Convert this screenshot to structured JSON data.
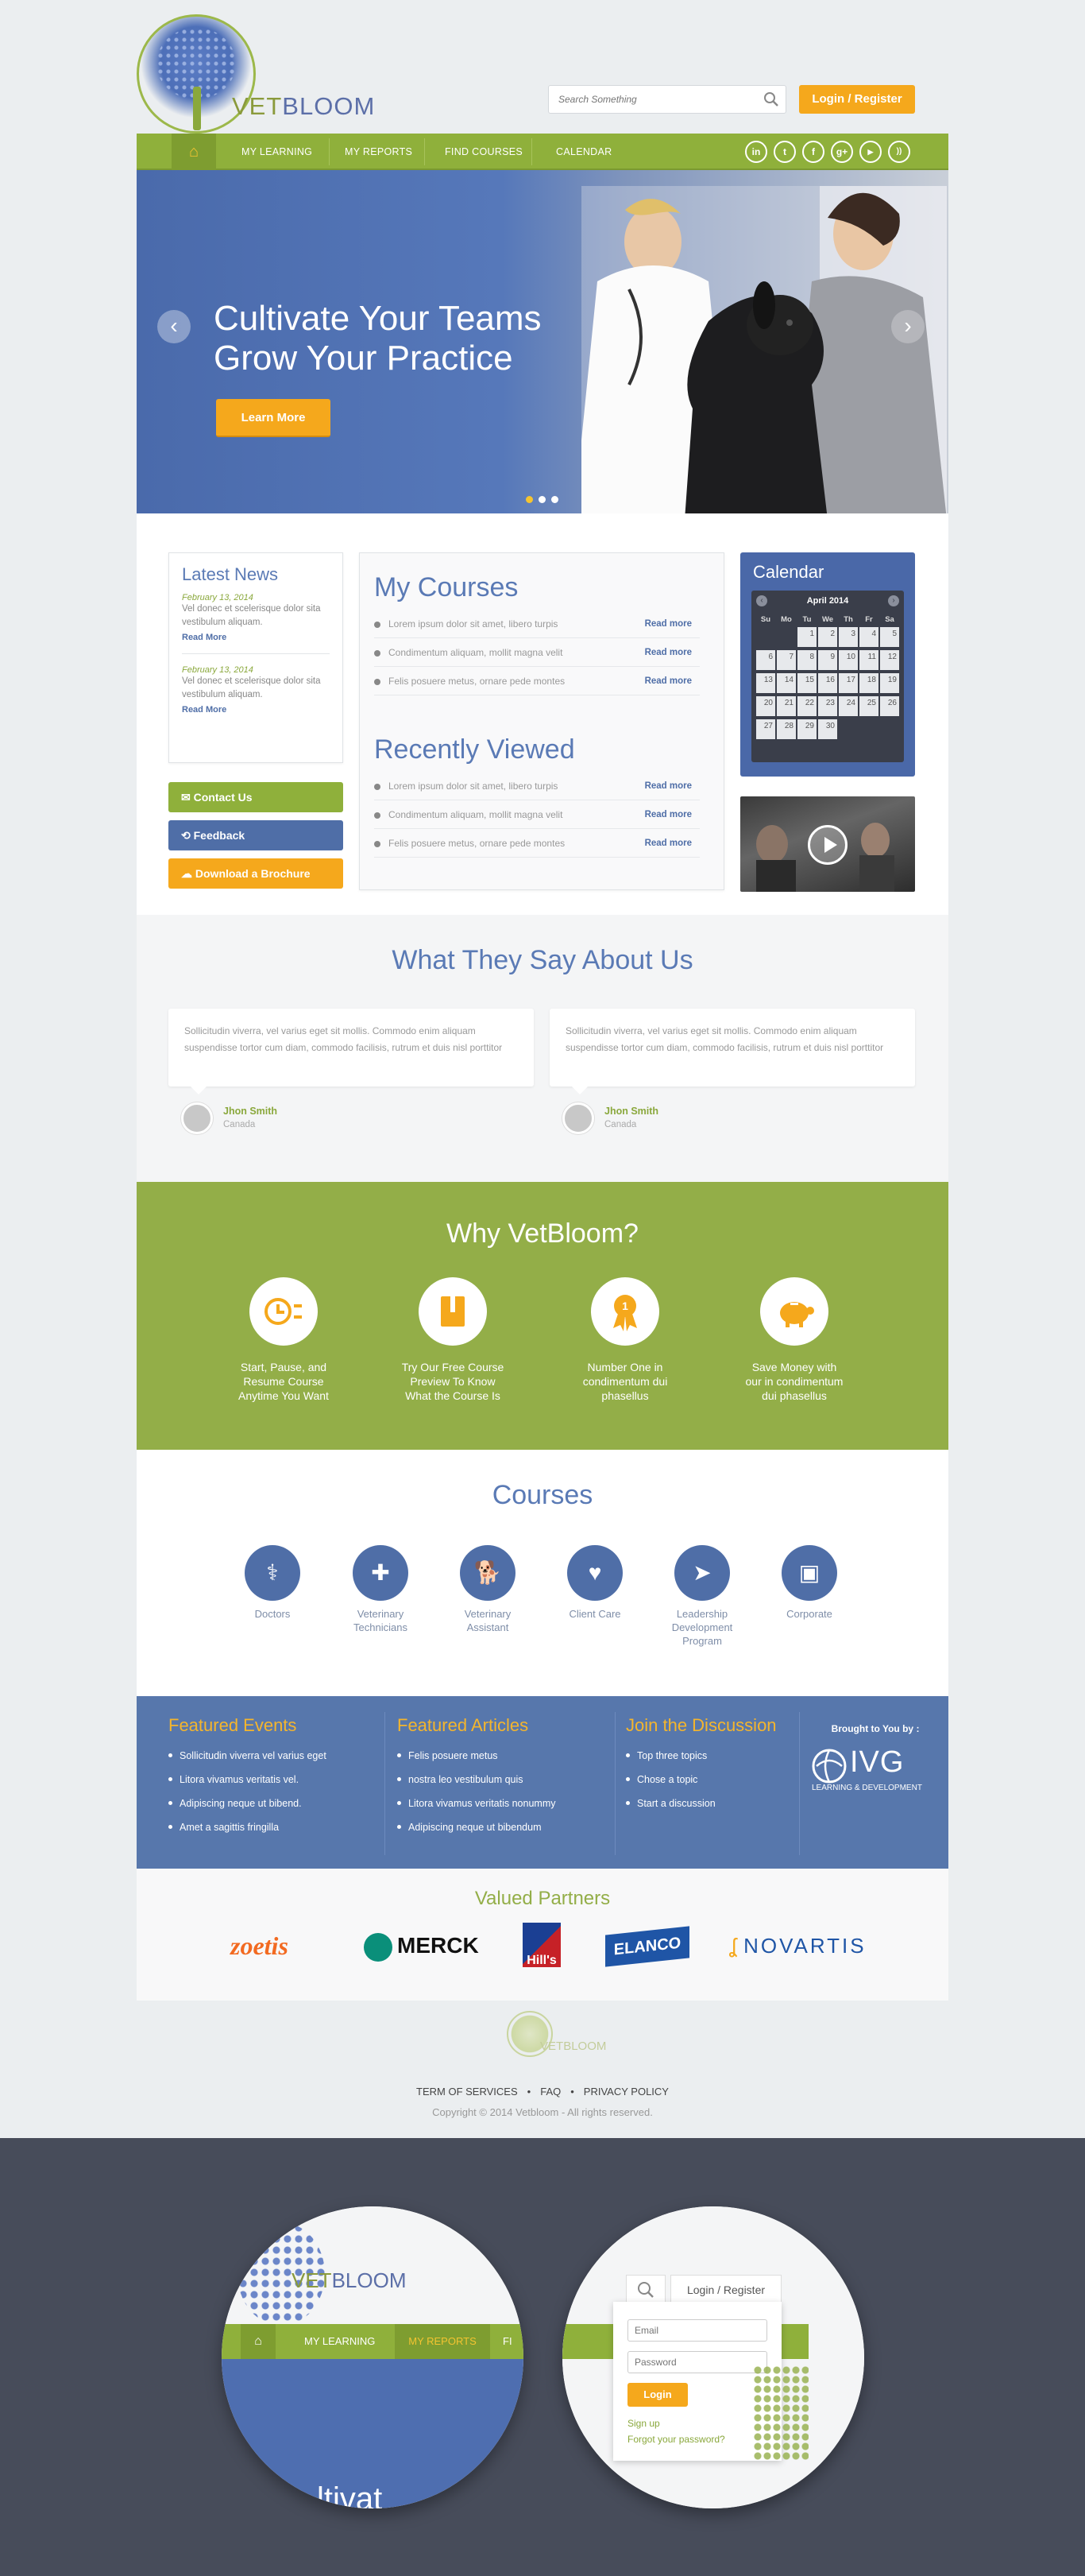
{
  "brand": {
    "name_part1": "VET",
    "name_part2": "BLOOM"
  },
  "search": {
    "placeholder": "Search Something"
  },
  "header": {
    "login_label": "Login / Register"
  },
  "nav": {
    "items": [
      {
        "label": "MY LEARNING"
      },
      {
        "label": "MY REPORTS"
      },
      {
        "label": "FIND COURSES"
      },
      {
        "label": "CALENDAR"
      }
    ],
    "social": [
      {
        "icon": "linkedin-icon",
        "glyph": "in"
      },
      {
        "icon": "twitter-icon",
        "glyph": "t"
      },
      {
        "icon": "facebook-icon",
        "glyph": "f"
      },
      {
        "icon": "googleplus-icon",
        "glyph": "g+"
      },
      {
        "icon": "youtube-icon",
        "glyph": "▶"
      },
      {
        "icon": "rss-icon",
        "glyph": "))"
      }
    ]
  },
  "hero": {
    "title_line1": "Cultivate Your Teams",
    "title_line2": "Grow Your Practice",
    "button": "Learn More"
  },
  "latest_news": {
    "heading": "Latest News",
    "items": [
      {
        "date": "February 13, 2014",
        "text": "Vel donec et scelerisque dolor sita vestibulum aliquam.",
        "link": "Read More"
      },
      {
        "date": "February 13, 2014",
        "text": "Vel donec et scelerisque dolor sita vestibulum aliquam.",
        "link": "Read More"
      }
    ]
  },
  "side_buttons": {
    "contact": "Contact Us",
    "feedback": "Feedback",
    "download": "Download a Brochure"
  },
  "my_courses": {
    "heading": "My Courses",
    "items": [
      {
        "text": "Lorem ipsum dolor sit amet, libero turpis",
        "link": "Read more"
      },
      {
        "text": "Condimentum aliquam, mollit magna velit",
        "link": "Read more"
      },
      {
        "text": "Felis posuere metus, ornare pede montes",
        "link": "Read more"
      }
    ]
  },
  "recently_viewed": {
    "heading": "Recently Viewed",
    "items": [
      {
        "text": "Lorem ipsum dolor sit amet, libero turpis",
        "link": "Read more"
      },
      {
        "text": "Condimentum aliquam, mollit magna velit",
        "link": "Read more"
      },
      {
        "text": "Felis posuere metus, ornare pede montes",
        "link": "Read more"
      }
    ]
  },
  "calendar": {
    "heading": "Calendar",
    "month": "April 2014",
    "weekdays": [
      "Su",
      "Mo",
      "Tu",
      "We",
      "Th",
      "Fr",
      "Sa"
    ],
    "days": [
      "",
      "",
      "1",
      "2",
      "3",
      "4",
      "5",
      "6",
      "7",
      "8",
      "9",
      "10",
      "11",
      "12",
      "13",
      "14",
      "15",
      "16",
      "17",
      "18",
      "19",
      "20",
      "21",
      "22",
      "23",
      "24",
      "25",
      "26",
      "27",
      "28",
      "29",
      "30",
      "",
      "",
      ""
    ]
  },
  "testimonials": {
    "heading": "What They Say About Us",
    "items": [
      {
        "quote": "Sollicitudin viverra, vel varius eget sit mollis. Commodo enim aliquam suspendisse tortor cum diam, commodo facilisis, rutrum et duis nisl porttitor",
        "name": "Jhon Smith",
        "location": "Canada"
      },
      {
        "quote": "Sollicitudin viverra, vel varius eget sit mollis. Commodo enim aliquam suspendisse tortor cum diam, commodo facilisis, rutrum et duis nisl porttitor",
        "name": "Jhon Smith",
        "location": "Canada"
      }
    ]
  },
  "why": {
    "heading": "Why VetBloom?",
    "items": [
      {
        "icon": "clock-icon",
        "lines": [
          "Start, Pause, and",
          "Resume Course",
          "Anytime You Want"
        ]
      },
      {
        "icon": "book-icon",
        "lines": [
          "Try Our Free Course",
          "Preview To Know",
          "What the Course Is"
        ]
      },
      {
        "icon": "award-icon",
        "lines": [
          "Number One in",
          "condimentum dui",
          "phasellus"
        ]
      },
      {
        "icon": "piggy-bank-icon",
        "lines": [
          "Save Money with",
          "our in condimentum",
          "dui phasellus"
        ]
      }
    ]
  },
  "courses": {
    "heading": "Courses",
    "items": [
      {
        "icon": "stethoscope-icon",
        "glyph": "⚕",
        "lines": [
          "Doctors"
        ]
      },
      {
        "icon": "medical-kit-icon",
        "glyph": "✚",
        "lines": [
          "Veterinary",
          "Technicians"
        ]
      },
      {
        "icon": "dog-icon",
        "glyph": "🐕",
        "lines": [
          "Veterinary",
          "Assistant"
        ]
      },
      {
        "icon": "heart-icon",
        "glyph": "♥",
        "lines": [
          "Client Care"
        ]
      },
      {
        "icon": "cursor-icon",
        "glyph": "➤",
        "lines": [
          "Leadership",
          "Development",
          "Program"
        ]
      },
      {
        "icon": "briefcase-icon",
        "glyph": "▣",
        "lines": [
          "Corporate"
        ]
      }
    ]
  },
  "footer_columns": {
    "events": {
      "heading": "Featured Events",
      "items": [
        "Sollicitudin viverra vel varius eget",
        "Litora vivamus veritatis vel.",
        "Adipiscing neque ut bibend.",
        "Amet a sagittis fringilla"
      ]
    },
    "articles": {
      "heading": "Featured Articles",
      "items": [
        "Felis posuere metus",
        "nostra leo vestibulum quis",
        "Litora vivamus veritatis nonummy",
        "Adipiscing neque ut bibendum"
      ]
    },
    "discussion": {
      "heading": "Join the Discussion",
      "items": [
        "Top three topics",
        "Chose a topic",
        "Start a discussion"
      ]
    },
    "brought": {
      "label": "Brought to You by :",
      "brand": "IVG",
      "tagline": "LEARNING & DEVELOPMENT"
    }
  },
  "partners": {
    "heading": "Valued Partners",
    "logos": [
      "zoetis",
      "MERCK",
      "Hill's",
      "ELANCO",
      "NOVARTIS"
    ]
  },
  "footer": {
    "links": [
      "TERM OF SERVICES",
      "FAQ",
      "PRIVACY POLICY"
    ],
    "copyright": "Copyright © 2014 Vetbloom -  All rights reserved."
  },
  "zoom_left": {
    "brand1": "VET",
    "brand2": "BLOOM",
    "nav": [
      "MY LEARNING",
      "MY REPORTS",
      "FI"
    ],
    "hero_fragment": "ltivat"
  },
  "zoom_right": {
    "login_label": "Login / Register",
    "email_placeholder": "Email",
    "password_placeholder": "Password",
    "login_button": "Login",
    "sign_up": "Sign up",
    "forgot": "Forgot your password?"
  },
  "colors": {
    "green": "#8fb03b",
    "blue": "#4f6ea7",
    "orange": "#f5a81c",
    "dark": "#474c5a"
  }
}
